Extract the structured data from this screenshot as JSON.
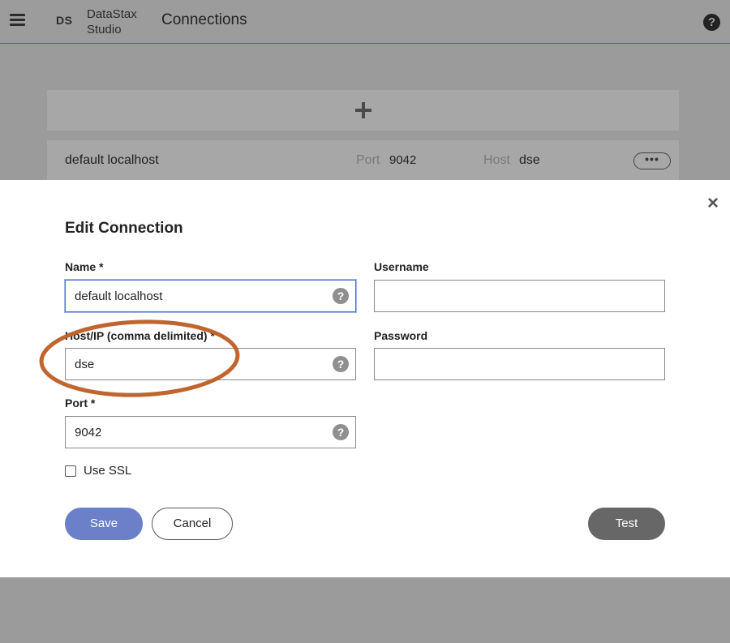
{
  "header": {
    "logo_mark": "DS",
    "logo_text_line1": "DataStax",
    "logo_text_line2": "Studio",
    "title": "Connections",
    "help_icon": "?"
  },
  "list": {
    "add_icon": "plus-icon",
    "row": {
      "name": "default localhost",
      "port_label": "Port",
      "port_value": "9042",
      "host_label": "Host",
      "host_value": "dse",
      "more_label": "•••"
    }
  },
  "modal": {
    "title": "Edit Connection",
    "close_icon": "×",
    "fields": {
      "name": {
        "label": "Name *",
        "value": "default localhost"
      },
      "host": {
        "label": "Host/IP (comma delimited) *",
        "value": "dse"
      },
      "port": {
        "label": "Port *",
        "value": "9042"
      },
      "username": {
        "label": "Username",
        "value": ""
      },
      "password": {
        "label": "Password",
        "value": ""
      }
    },
    "help_glyph": "?",
    "ssl_label": "Use SSL",
    "buttons": {
      "save": "Save",
      "cancel": "Cancel",
      "test": "Test"
    }
  },
  "colors": {
    "accent": "#6b80c8",
    "overlay": "#9b9b9b",
    "annotation": "#c0652e",
    "test_button": "#676767"
  }
}
